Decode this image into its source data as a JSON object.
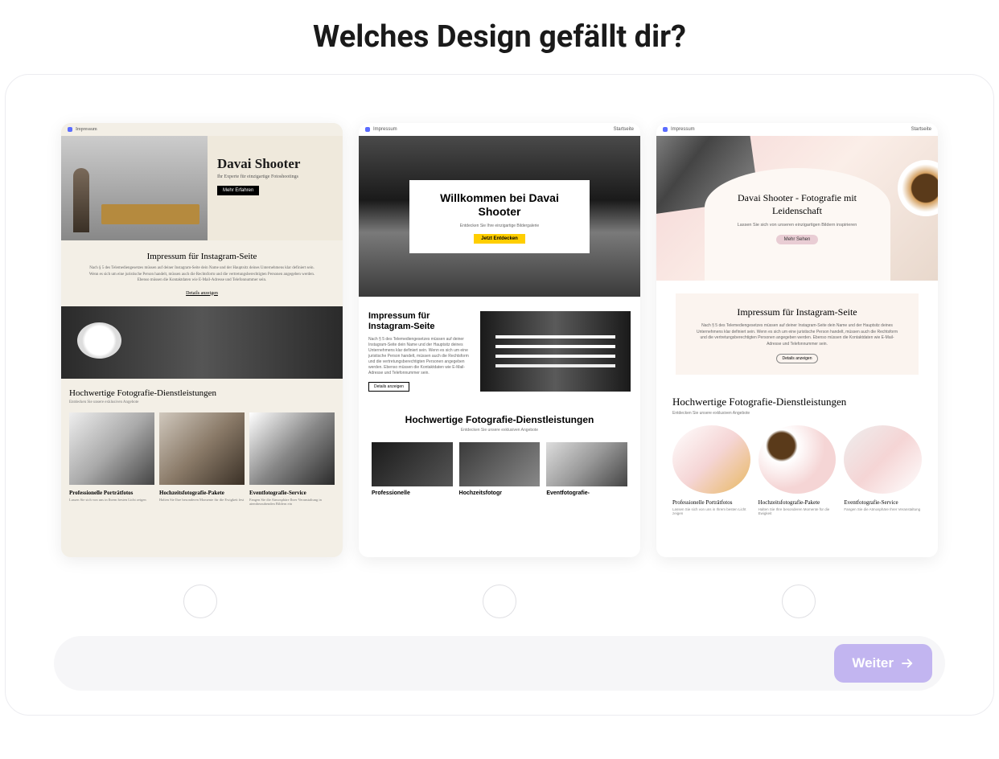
{
  "page": {
    "title": "Welches Design gefällt dir?",
    "next_button": "Weiter"
  },
  "common": {
    "topbar_text": "Impressum",
    "topbar_right": "Startseite"
  },
  "design1": {
    "hero_title": "Davai Shooter",
    "hero_subtitle": "Ihr Experte für einzigartige Fotoshootings",
    "hero_button": "Mehr Erfahren",
    "impressum_title": "Impressum für Instagram-Seite",
    "impressum_body": "Nach § 5 des Telemediengesetzes müssen auf deiner Instagram-Seite dein Name und der Hauptsitz deines Unternehmens klar definiert sein. Wenn es sich um eine juristische Person handelt, müssen auch die Rechtsform und die vertretungsberechtigten Personen angegeben werden. Ebenso müssen die Kontaktdaten wie E-Mail-Adresse und Telefonnummer sein.",
    "impressum_link": "Details anzeigen",
    "services_title": "Hochwertige Fotografie-Dienstleistungen",
    "services_sub": "Entdecken Sie unsere exklusiven Angebote",
    "cards": [
      {
        "title": "Professionelle Porträtfotos",
        "body": "Lassen Sie sich von uns in Ihrem besten Licht zeigen"
      },
      {
        "title": "Hochzeitsfotografie-Pakete",
        "body": "Halten Sie Ihre besonderen Momente für die Ewigkeit fest"
      },
      {
        "title": "Eventfotografie-Service",
        "body": "Fangen Sie die Atmosphäre Ihrer Veranstaltung in atemberaubenden Bildern ein"
      }
    ]
  },
  "design2": {
    "hero_title": "Willkommen bei Davai Shooter",
    "hero_subtitle": "Entdecken Sie Ihre einzigartige Bildergalerie",
    "hero_button": "Jetzt Entdecken",
    "impressum_title": "Impressum für Instagram-Seite",
    "impressum_body": "Nach § 5 des Telemediengesetzes müssen auf deiner Instagram-Seite dein Name und der Hauptsitz deines Unternehmens klar definiert sein. Wenn es sich um eine juristische Person handelt, müssen auch die Rechtsform und die vertretungsberechtigten Personen angegeben werden. Ebenso müssen die Kontaktdaten wie E-Mail-Adresse und Telefonnummer sein.",
    "impressum_button": "Details anzeigen",
    "services_title": "Hochwertige Fotografie-Dienstleistungen",
    "services_sub": "Entdecken Sie unsere exklusiven Angebote",
    "cards": [
      {
        "title": "Professionelle"
      },
      {
        "title": "Hochzeitsfotogr"
      },
      {
        "title": "Eventfotografie-"
      }
    ]
  },
  "design3": {
    "hero_title": "Davai Shooter - Fotografie mit Leidenschaft",
    "hero_subtitle": "Lassen Sie sich von unseren einzigartigen Bildern inspirieren",
    "hero_button": "Mehr Sehen",
    "impressum_title": "Impressum für Instagram-Seite",
    "impressum_body": "Nach § 5 des Telemediengesetzes müssen auf deiner Instagram-Seite dein Name und der Hauptsitz deines Unternehmens klar definiert sein. Wenn es sich um eine juristische Person handelt, müssen auch die Rechtsform und die vertretungsberechtigten Personen angegeben werden. Ebenso müssen die Kontaktdaten wie E-Mail-Adresse und Telefonnummer sein.",
    "impressum_button": "Details anzeigen",
    "services_title": "Hochwertige Fotografie-Dienstleistungen",
    "services_sub": "Entdecken Sie unsere exklusiven Angebote",
    "cards": [
      {
        "title": "Professionelle Porträtfotos",
        "body": "Lassen Sie sich von uns in Ihrem besten Licht zeigen"
      },
      {
        "title": "Hochzeitsfotografie-Pakete",
        "body": "Halten Sie Ihre besonderen Momente für die Ewigkeit"
      },
      {
        "title": "Eventfotografie-Service",
        "body": "Fangen Sie die Atmosphäre Ihrer Veranstaltung"
      }
    ]
  }
}
